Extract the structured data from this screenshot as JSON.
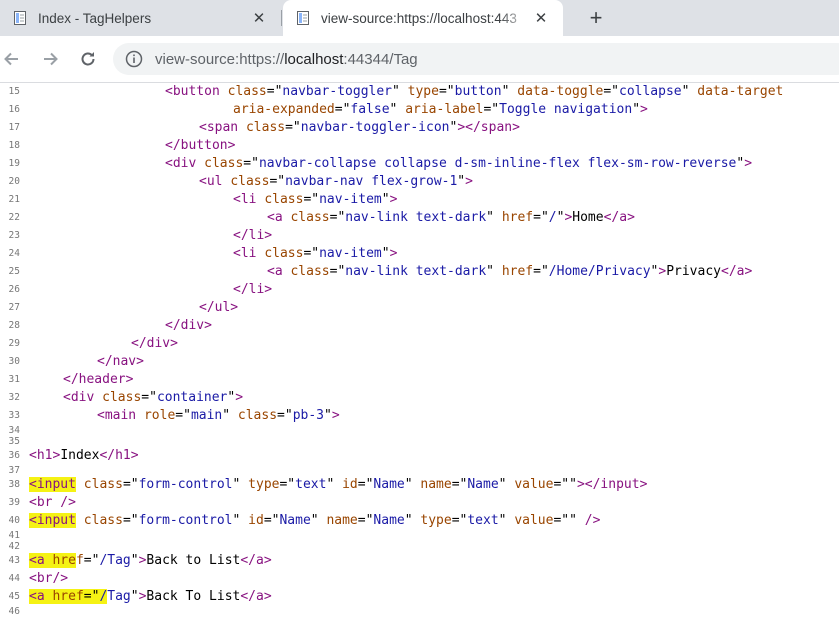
{
  "tabs": [
    {
      "title": "Index - TagHelpers",
      "active": false,
      "icon": "document-icon"
    },
    {
      "title": "view-source:https://localhost:443",
      "active": true,
      "icon": "document-icon"
    }
  ],
  "toolbar": {
    "url_scheme": "view-source:https://",
    "url_host": "localhost",
    "url_rest": ":44344/Tag"
  },
  "colors": {
    "tag": "#881280",
    "attr": "#994500",
    "value": "#1a1aa6",
    "highlight": "#f5f214"
  },
  "source_lines": [
    {
      "n": "15",
      "indent": 16,
      "tokens": [
        {
          "t": "tag",
          "v": "<button "
        },
        {
          "t": "attr",
          "v": "class"
        },
        {
          "t": "txt",
          "v": "=\""
        },
        {
          "t": "val",
          "v": "navbar-toggler"
        },
        {
          "t": "txt",
          "v": "\" "
        },
        {
          "t": "attr",
          "v": "type"
        },
        {
          "t": "txt",
          "v": "=\""
        },
        {
          "t": "val",
          "v": "button"
        },
        {
          "t": "txt",
          "v": "\" "
        },
        {
          "t": "attr",
          "v": "data-toggle"
        },
        {
          "t": "txt",
          "v": "=\""
        },
        {
          "t": "val",
          "v": "collapse"
        },
        {
          "t": "txt",
          "v": "\" "
        },
        {
          "t": "attr",
          "v": "data-target"
        }
      ]
    },
    {
      "n": "16",
      "indent": 24,
      "tokens": [
        {
          "t": "attr",
          "v": "aria-expanded"
        },
        {
          "t": "txt",
          "v": "=\""
        },
        {
          "t": "val",
          "v": "false"
        },
        {
          "t": "txt",
          "v": "\" "
        },
        {
          "t": "attr",
          "v": "aria-label"
        },
        {
          "t": "txt",
          "v": "=\""
        },
        {
          "t": "val",
          "v": "Toggle navigation"
        },
        {
          "t": "txt",
          "v": "\""
        },
        {
          "t": "tag",
          "v": ">"
        }
      ]
    },
    {
      "n": "17",
      "indent": 20,
      "tokens": [
        {
          "t": "tag",
          "v": "<span "
        },
        {
          "t": "attr",
          "v": "class"
        },
        {
          "t": "txt",
          "v": "=\""
        },
        {
          "t": "val",
          "v": "navbar-toggler-icon"
        },
        {
          "t": "txt",
          "v": "\""
        },
        {
          "t": "tag",
          "v": "></span>"
        }
      ]
    },
    {
      "n": "18",
      "indent": 16,
      "tokens": [
        {
          "t": "tag",
          "v": "</button>"
        }
      ]
    },
    {
      "n": "19",
      "indent": 16,
      "tokens": [
        {
          "t": "tag",
          "v": "<div "
        },
        {
          "t": "attr",
          "v": "class"
        },
        {
          "t": "txt",
          "v": "=\""
        },
        {
          "t": "val",
          "v": "navbar-collapse collapse d-sm-inline-flex flex-sm-row-reverse"
        },
        {
          "t": "txt",
          "v": "\""
        },
        {
          "t": "tag",
          "v": ">"
        }
      ]
    },
    {
      "n": "20",
      "indent": 20,
      "tokens": [
        {
          "t": "tag",
          "v": "<ul "
        },
        {
          "t": "attr",
          "v": "class"
        },
        {
          "t": "txt",
          "v": "=\""
        },
        {
          "t": "val",
          "v": "navbar-nav flex-grow-1"
        },
        {
          "t": "txt",
          "v": "\""
        },
        {
          "t": "tag",
          "v": ">"
        }
      ]
    },
    {
      "n": "21",
      "indent": 24,
      "tokens": [
        {
          "t": "tag",
          "v": "<li "
        },
        {
          "t": "attr",
          "v": "class"
        },
        {
          "t": "txt",
          "v": "=\""
        },
        {
          "t": "val",
          "v": "nav-item"
        },
        {
          "t": "txt",
          "v": "\""
        },
        {
          "t": "tag",
          "v": ">"
        }
      ]
    },
    {
      "n": "22",
      "indent": 28,
      "tokens": [
        {
          "t": "tag",
          "v": "<a "
        },
        {
          "t": "attr",
          "v": "class"
        },
        {
          "t": "txt",
          "v": "=\""
        },
        {
          "t": "val",
          "v": "nav-link text-dark"
        },
        {
          "t": "txt",
          "v": "\" "
        },
        {
          "t": "attr",
          "v": "href"
        },
        {
          "t": "txt",
          "v": "=\""
        },
        {
          "t": "val",
          "v": "/"
        },
        {
          "t": "txt",
          "v": "\""
        },
        {
          "t": "tag",
          "v": ">"
        },
        {
          "t": "txt",
          "v": "Home"
        },
        {
          "t": "tag",
          "v": "</a>"
        }
      ]
    },
    {
      "n": "23",
      "indent": 24,
      "tokens": [
        {
          "t": "tag",
          "v": "</li>"
        }
      ]
    },
    {
      "n": "24",
      "indent": 24,
      "tokens": [
        {
          "t": "tag",
          "v": "<li "
        },
        {
          "t": "attr",
          "v": "class"
        },
        {
          "t": "txt",
          "v": "=\""
        },
        {
          "t": "val",
          "v": "nav-item"
        },
        {
          "t": "txt",
          "v": "\""
        },
        {
          "t": "tag",
          "v": ">"
        }
      ]
    },
    {
      "n": "25",
      "indent": 28,
      "tokens": [
        {
          "t": "tag",
          "v": "<a "
        },
        {
          "t": "attr",
          "v": "class"
        },
        {
          "t": "txt",
          "v": "=\""
        },
        {
          "t": "val",
          "v": "nav-link text-dark"
        },
        {
          "t": "txt",
          "v": "\" "
        },
        {
          "t": "attr",
          "v": "href"
        },
        {
          "t": "txt",
          "v": "=\""
        },
        {
          "t": "val",
          "v": "/Home/Privacy"
        },
        {
          "t": "txt",
          "v": "\""
        },
        {
          "t": "tag",
          "v": ">"
        },
        {
          "t": "txt",
          "v": "Privacy"
        },
        {
          "t": "tag",
          "v": "</a>"
        }
      ]
    },
    {
      "n": "26",
      "indent": 24,
      "tokens": [
        {
          "t": "tag",
          "v": "</li>"
        }
      ]
    },
    {
      "n": "27",
      "indent": 20,
      "tokens": [
        {
          "t": "tag",
          "v": "</ul>"
        }
      ]
    },
    {
      "n": "28",
      "indent": 16,
      "tokens": [
        {
          "t": "tag",
          "v": "</div>"
        }
      ]
    },
    {
      "n": "29",
      "indent": 12,
      "tokens": [
        {
          "t": "tag",
          "v": "</div>"
        }
      ]
    },
    {
      "n": "30",
      "indent": 8,
      "tokens": [
        {
          "t": "tag",
          "v": "</nav>"
        }
      ]
    },
    {
      "n": "31",
      "indent": 4,
      "tokens": [
        {
          "t": "tag",
          "v": "</header>"
        }
      ]
    },
    {
      "n": "32",
      "indent": 4,
      "tokens": [
        {
          "t": "tag",
          "v": "<div "
        },
        {
          "t": "attr",
          "v": "class"
        },
        {
          "t": "txt",
          "v": "=\""
        },
        {
          "t": "val",
          "v": "container"
        },
        {
          "t": "txt",
          "v": "\""
        },
        {
          "t": "tag",
          "v": ">"
        }
      ]
    },
    {
      "n": "33",
      "indent": 8,
      "tokens": [
        {
          "t": "tag",
          "v": "<main "
        },
        {
          "t": "attr",
          "v": "role"
        },
        {
          "t": "txt",
          "v": "=\""
        },
        {
          "t": "val",
          "v": "main"
        },
        {
          "t": "txt",
          "v": "\" "
        },
        {
          "t": "attr",
          "v": "class"
        },
        {
          "t": "txt",
          "v": "=\""
        },
        {
          "t": "val",
          "v": "pb-3"
        },
        {
          "t": "txt",
          "v": "\""
        },
        {
          "t": "tag",
          "v": ">"
        }
      ]
    },
    {
      "n": "34",
      "indent": 0,
      "short": true,
      "tokens": []
    },
    {
      "n": "35",
      "indent": 0,
      "short": true,
      "tokens": []
    },
    {
      "n": "36",
      "indent": 0,
      "tokens": [
        {
          "t": "tag",
          "v": "<h1>"
        },
        {
          "t": "txt",
          "v": "Index"
        },
        {
          "t": "tag",
          "v": "</h1>"
        }
      ]
    },
    {
      "n": "37",
      "indent": 0,
      "short": true,
      "tokens": []
    },
    {
      "n": "38",
      "indent": 0,
      "tokens": [
        {
          "t": "tag",
          "v": "<input",
          "hl": true
        },
        {
          "t": "tag",
          "v": " "
        },
        {
          "t": "attr",
          "v": "class"
        },
        {
          "t": "txt",
          "v": "=\""
        },
        {
          "t": "val",
          "v": "form-control"
        },
        {
          "t": "txt",
          "v": "\" "
        },
        {
          "t": "attr",
          "v": "type"
        },
        {
          "t": "txt",
          "v": "=\""
        },
        {
          "t": "val",
          "v": "text"
        },
        {
          "t": "txt",
          "v": "\" "
        },
        {
          "t": "attr",
          "v": "id"
        },
        {
          "t": "txt",
          "v": "=\""
        },
        {
          "t": "val",
          "v": "Name"
        },
        {
          "t": "txt",
          "v": "\" "
        },
        {
          "t": "attr",
          "v": "name"
        },
        {
          "t": "txt",
          "v": "=\""
        },
        {
          "t": "val",
          "v": "Name"
        },
        {
          "t": "txt",
          "v": "\" "
        },
        {
          "t": "attr",
          "v": "value"
        },
        {
          "t": "txt",
          "v": "=\"\""
        },
        {
          "t": "tag",
          "v": "></input>"
        }
      ]
    },
    {
      "n": "39",
      "indent": 0,
      "tokens": [
        {
          "t": "tag",
          "v": "<br />"
        }
      ]
    },
    {
      "n": "40",
      "indent": 0,
      "tokens": [
        {
          "t": "tag",
          "v": "<input",
          "hl": true
        },
        {
          "t": "tag",
          "v": " "
        },
        {
          "t": "attr",
          "v": "class"
        },
        {
          "t": "txt",
          "v": "=\""
        },
        {
          "t": "val",
          "v": "form-control"
        },
        {
          "t": "txt",
          "v": "\" "
        },
        {
          "t": "attr",
          "v": "id"
        },
        {
          "t": "txt",
          "v": "=\""
        },
        {
          "t": "val",
          "v": "Name"
        },
        {
          "t": "txt",
          "v": "\" "
        },
        {
          "t": "attr",
          "v": "name"
        },
        {
          "t": "txt",
          "v": "=\""
        },
        {
          "t": "val",
          "v": "Name"
        },
        {
          "t": "txt",
          "v": "\" "
        },
        {
          "t": "attr",
          "v": "type"
        },
        {
          "t": "txt",
          "v": "=\""
        },
        {
          "t": "val",
          "v": "text"
        },
        {
          "t": "txt",
          "v": "\" "
        },
        {
          "t": "attr",
          "v": "value"
        },
        {
          "t": "txt",
          "v": "=\"\" "
        },
        {
          "t": "tag",
          "v": "/>"
        }
      ]
    },
    {
      "n": "41",
      "indent": 0,
      "short": true,
      "tokens": []
    },
    {
      "n": "42",
      "indent": 0,
      "short": true,
      "tokens": []
    },
    {
      "n": "43",
      "indent": 0,
      "tokens": [
        {
          "t": "tag",
          "v": "<a ",
          "hl": true
        },
        {
          "t": "attr",
          "v": "hre",
          "hl": true
        },
        {
          "t": "attr",
          "v": "f"
        },
        {
          "t": "txt",
          "v": "=\""
        },
        {
          "t": "val",
          "v": "/Tag"
        },
        {
          "t": "txt",
          "v": "\""
        },
        {
          "t": "tag",
          "v": ">"
        },
        {
          "t": "txt",
          "v": "Back to List"
        },
        {
          "t": "tag",
          "v": "</a>"
        }
      ]
    },
    {
      "n": "44",
      "indent": 0,
      "tokens": [
        {
          "t": "tag",
          "v": "<br/>"
        }
      ]
    },
    {
      "n": "45",
      "indent": 0,
      "tokens": [
        {
          "t": "tag",
          "v": "<a ",
          "hl": true
        },
        {
          "t": "attr",
          "v": "href",
          "hl": true
        },
        {
          "t": "txt",
          "v": "=\"",
          "hl": true
        },
        {
          "t": "val",
          "v": "/",
          "hl": true
        },
        {
          "t": "val",
          "v": "Tag"
        },
        {
          "t": "txt",
          "v": "\""
        },
        {
          "t": "tag",
          "v": ">"
        },
        {
          "t": "txt",
          "v": "Back To List"
        },
        {
          "t": "tag",
          "v": "</a>"
        }
      ]
    },
    {
      "n": "46",
      "indent": 0,
      "short": true,
      "tokens": []
    }
  ]
}
